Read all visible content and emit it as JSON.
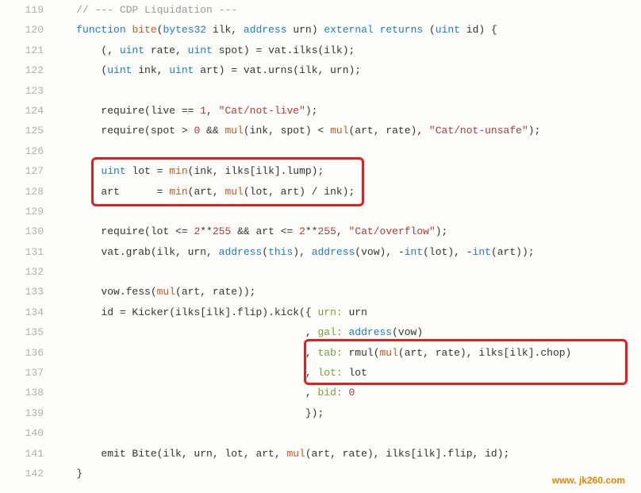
{
  "gutter": [
    "119",
    "120",
    "121",
    "122",
    "123",
    "124",
    "125",
    "126",
    "127",
    "128",
    "129",
    "130",
    "131",
    "132",
    "133",
    "134",
    "135",
    "136",
    "137",
    "138",
    "139",
    "140",
    "141",
    "142"
  ],
  "watermark": "www. jk260.com",
  "code": {
    "l119": {
      "c0": "    // --- CDP Liquidation ---"
    },
    "l120": {
      "c0": "    ",
      "c1": "function",
      "c2": " ",
      "c3": "bite",
      "c4": "(",
      "c5": "bytes32",
      "c6": " ilk, ",
      "c7": "address",
      "c8": " urn) ",
      "c9": "external",
      "c10": " ",
      "c11": "returns",
      "c12": " (",
      "c13": "uint",
      "c14": " id) {"
    },
    "l121": {
      "c0": "        (, ",
      "c1": "uint",
      "c2": " rate, ",
      "c3": "uint",
      "c4": " spot) = vat.ilks(ilk);"
    },
    "l122": {
      "c0": "        (",
      "c1": "uint",
      "c2": " ink, ",
      "c3": "uint",
      "c4": " art) = vat.urns(ilk, urn);"
    },
    "l123": {
      "c0": ""
    },
    "l124": {
      "c0": "        require(live == ",
      "c1": "1",
      "c2": ", ",
      "c3": "\"Cat/not-live\"",
      "c4": ");"
    },
    "l125": {
      "c0": "        require(spot > ",
      "c1": "0",
      "c2": " && ",
      "c3": "mul",
      "c4": "(ink, spot) < ",
      "c5": "mul",
      "c6": "(art, rate), ",
      "c7": "\"Cat/not-unsafe\"",
      "c8": ");"
    },
    "l126": {
      "c0": ""
    },
    "l127": {
      "c0": "        ",
      "c1": "uint",
      "c2": " lot = ",
      "c3": "min",
      "c4": "(ink, ilks[ilk].lump);"
    },
    "l128": {
      "c0": "        art      = ",
      "c1": "min",
      "c2": "(art, ",
      "c3": "mul",
      "c4": "(lot, art) / ink);"
    },
    "l129": {
      "c0": ""
    },
    "l130": {
      "c0": "        require(lot <= ",
      "c1": "2",
      "c2": "**",
      "c3": "255",
      "c4": " && art <= ",
      "c5": "2",
      "c6": "**",
      "c7": "255",
      "c8": ", ",
      "c9": "\"Cat/overflow\"",
      "c10": ");"
    },
    "l131": {
      "c0": "        vat.grab(ilk, urn, ",
      "c1": "address",
      "c2": "(",
      "c3": "this",
      "c4": "), ",
      "c5": "address",
      "c6": "(vow), -",
      "c7": "int",
      "c8": "(lot), -",
      "c9": "int",
      "c10": "(art));"
    },
    "l132": {
      "c0": ""
    },
    "l133": {
      "c0": "        vow.fess(",
      "c1": "mul",
      "c2": "(art, rate));"
    },
    "l134": {
      "c0": "        id = Kicker(ilks[ilk].flip).kick({ ",
      "c1": "urn:",
      "c2": " urn"
    },
    "l135": {
      "c0": "                                         , ",
      "c1": "gal:",
      "c2": " ",
      "c3": "address",
      "c4": "(vow)"
    },
    "l136": {
      "c0": "                                         , ",
      "c1": "tab:",
      "c2": " rmul(",
      "c3": "mul",
      "c4": "(art, rate), ilks[ilk].chop)"
    },
    "l137": {
      "c0": "                                         , ",
      "c1": "lot:",
      "c2": " lot"
    },
    "l138": {
      "c0": "                                         , ",
      "c1": "bid:",
      "c2": " ",
      "c3": "0"
    },
    "l139": {
      "c0": "                                         });"
    },
    "l140": {
      "c0": ""
    },
    "l141": {
      "c0": "        emit Bite(ilk, urn, lot, art, ",
      "c1": "mul",
      "c2": "(art, rate), ilks[ilk].flip, id);"
    },
    "l142": {
      "c0": "    }"
    }
  }
}
